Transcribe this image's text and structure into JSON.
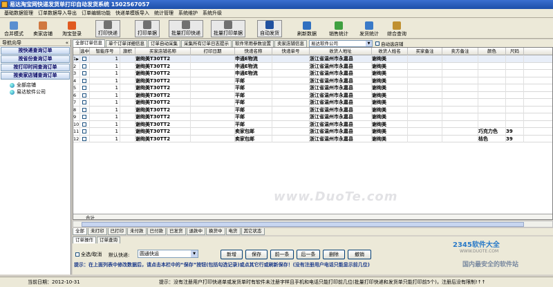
{
  "window": {
    "title": "易达淘宝网快递发货单打印自动发货系统    1502567057"
  },
  "menu": [
    "基础数据管理",
    "订单数据导入导出",
    "订单编辑功能",
    "快递单模板导入",
    "统计管理",
    "系统维护",
    "系统升级"
  ],
  "toolbar": [
    {
      "label": "合并模式",
      "icon": "merge-icon",
      "color": "#5b8fd0"
    },
    {
      "label": "卖家店铺",
      "icon": "shop-icon",
      "color": "#d07840"
    },
    {
      "label": "淘宝登录",
      "icon": "taobao-icon",
      "color": "#e05a20"
    },
    {
      "label": "打印快递",
      "icon": "printer-icon",
      "color": "#707070"
    },
    {
      "label": "打印单据",
      "icon": "printer-icon",
      "color": "#707070"
    },
    {
      "label": "批量打印快递",
      "icon": "printer-icon",
      "color": "#707070"
    },
    {
      "label": "批量打印单据",
      "icon": "printer-icon",
      "color": "#707070"
    },
    {
      "label": "自动发货",
      "icon": "globe-icon",
      "color": "#2050a0"
    },
    {
      "label": "刷新数据",
      "icon": "refresh-icon",
      "color": "#3070c0"
    },
    {
      "label": "销售统计",
      "icon": "chart-icon",
      "color": "#40a040"
    },
    {
      "label": "发货统计",
      "icon": "truck-icon",
      "color": "#3a7ac8"
    },
    {
      "label": "综合查询",
      "icon": "search-icon",
      "color": "#c09030"
    }
  ],
  "nav": {
    "title": "导航向导",
    "collapse": "«",
    "buttons": [
      "按快递查询订单",
      "按省份查询订单",
      "按打印时间查询订单",
      "按卖家店铺查询订单"
    ],
    "tree": [
      "全部店铺",
      "易达软件公司"
    ]
  },
  "tabs": [
    "全部订单信息",
    "单个订单详细信息",
    "订单自动采集",
    "采集所有订单日志提示",
    "软件常用参数设置",
    "卖家店铺信息"
  ],
  "shop_select": "易达软件公司",
  "auto_select": "自动选店铺",
  "grid": {
    "columns": [
      "选中",
      "智能序号",
      "旗帜",
      "买家店铺名称",
      "打印日期",
      "快递名称",
      "快递单号",
      "收货人地址",
      "收货人姓名",
      "买家备注",
      "卖方备注",
      "颜色",
      "尺码"
    ],
    "rows": [
      {
        "n": "1",
        "seq": "1",
        "buyer": "谢绚美T30TT2",
        "courier": "申通E物流",
        "addr": "浙江省温州市永嘉县",
        "name": "谢绚美",
        "color": "",
        "size": ""
      },
      {
        "n": "2",
        "seq": "1",
        "buyer": "谢绚美T30TT2",
        "courier": "申通E物流",
        "addr": "浙江省温州市永嘉县",
        "name": "谢绚美",
        "color": "",
        "size": ""
      },
      {
        "n": "3",
        "seq": "1",
        "buyer": "谢绚美T30TT2",
        "courier": "申通E物流",
        "addr": "浙江省温州市永嘉县",
        "name": "谢绚美",
        "color": "",
        "size": ""
      },
      {
        "n": "4",
        "seq": "1",
        "buyer": "谢绚美T30TT2",
        "courier": "平邮",
        "addr": "浙江省温州市永嘉县",
        "name": "谢绚美",
        "color": "",
        "size": ""
      },
      {
        "n": "5",
        "seq": "1",
        "buyer": "谢绚美T30TT2",
        "courier": "平邮",
        "addr": "浙江省温州市永嘉县",
        "name": "谢绚美",
        "color": "",
        "size": ""
      },
      {
        "n": "6",
        "seq": "1",
        "buyer": "谢绚美T30TT2",
        "courier": "平邮",
        "addr": "浙江省温州市永嘉县",
        "name": "谢绚美",
        "color": "",
        "size": ""
      },
      {
        "n": "7",
        "seq": "1",
        "buyer": "谢绚美T30TT2",
        "courier": "平邮",
        "addr": "浙江省温州市永嘉县",
        "name": "谢绚美",
        "color": "",
        "size": ""
      },
      {
        "n": "8",
        "seq": "1",
        "buyer": "谢绚美T30TT2",
        "courier": "平邮",
        "addr": "浙江省温州市永嘉县",
        "name": "谢绚美",
        "color": "",
        "size": ""
      },
      {
        "n": "9",
        "seq": "1",
        "buyer": "谢绚美T30TT2",
        "courier": "平邮",
        "addr": "浙江省温州市永嘉县",
        "name": "谢绚美",
        "color": "",
        "size": ""
      },
      {
        "n": "10",
        "seq": "1",
        "buyer": "谢绚美T30TT2",
        "courier": "平邮",
        "addr": "浙江省温州市永嘉县",
        "name": "谢绚美",
        "color": "",
        "size": ""
      },
      {
        "n": "11",
        "seq": "1",
        "buyer": "谢绚美T30TT2",
        "courier": "卖家包邮",
        "addr": "浙江省温州市永嘉县",
        "name": "谢绚美",
        "color": "巧克力色",
        "size": "39"
      },
      {
        "n": "12",
        "seq": "1",
        "buyer": "谢绚美T30TT2",
        "courier": "卖家包邮",
        "addr": "浙江省温州市永嘉县",
        "name": "谢绚美",
        "color": "桔色",
        "size": "39"
      }
    ],
    "total_label": "合计"
  },
  "filter_tabs": [
    "全部",
    "未打印",
    "已打印",
    "未付款",
    "已付款",
    "已发货",
    "退款中",
    "换货中",
    "电货",
    "其它状态"
  ],
  "op_tabs": [
    "订单操作",
    "订单查询"
  ],
  "ops": {
    "select_all": "全选/取消",
    "default_courier_label": "默认快递:",
    "default_courier_value": "圆通快运",
    "buttons": [
      "新增",
      "保存",
      "前一条",
      "后一条",
      "删除",
      "撤销"
    ],
    "tip": "提示：在上面列表中修改数据后，请点击本栏中的“保存”按钮(包括勾选记录)或点其它行或刷新保存！(没有注册用户电话只能显示前几位)"
  },
  "status": {
    "date": "当前日期：2012-10-31",
    "message": "提示：没有注册用户打印快递单或发货单时有软件未注册字样且手机和电话只能打印前几位(批量打印快递和发货单只能打印前5个)，注册后没有限制!↑↑"
  },
  "watermark": "www.DuoTe.com",
  "logo": {
    "l1": "2345软件大全",
    "l2": "WWW.DUOTE.COM",
    "l3": "国内最安全的软件站"
  }
}
